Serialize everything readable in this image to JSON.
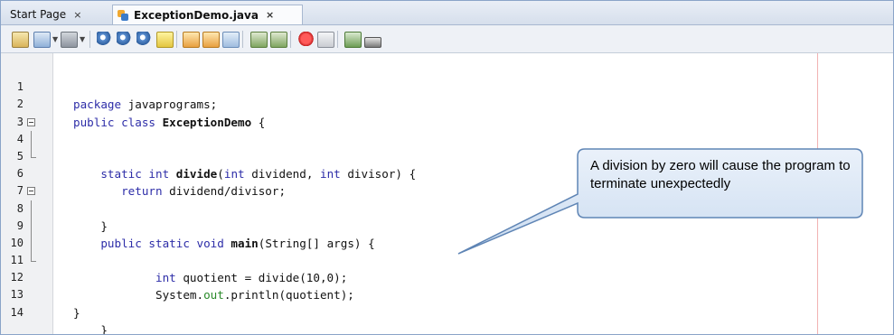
{
  "tabs": [
    {
      "label": "Start Page",
      "active": false,
      "close": "×"
    },
    {
      "label": "ExceptionDemo.java",
      "active": true,
      "close": "×",
      "icon": "java-file-icon"
    }
  ],
  "toolbar": {
    "buttons": [
      "last-edit-icon",
      "back-icon",
      "forward-icon",
      "find-selection-icon",
      "find-previous-icon",
      "find-next-icon",
      "toggle-highlight-icon",
      "previous-bookmark-icon",
      "next-bookmark-icon",
      "toggle-bookmark-icon",
      "shift-left-icon",
      "shift-right-icon",
      "start-macro-icon",
      "stop-macro-icon",
      "comment-icon",
      "uncomment-icon"
    ]
  },
  "editor": {
    "lines": [
      {
        "num": "1",
        "code": "package javaprograms;"
      },
      {
        "num": "2",
        "code": "public class ExceptionDemo {"
      },
      {
        "num": "3",
        "code": ""
      },
      {
        "num": "4",
        "code": "    static int divide(int dividend, int divisor) {"
      },
      {
        "num": "5",
        "code": "       return dividend/divisor;"
      },
      {
        "num": "6",
        "code": "    }"
      },
      {
        "num": "7",
        "code": ""
      },
      {
        "num": "8",
        "code": "    public static void main(String[] args) {"
      },
      {
        "num": "9",
        "code": ""
      },
      {
        "num": "10",
        "code": "            int quotient = divide(10,0);"
      },
      {
        "num": "11",
        "code": "            System.out.println(quotient);"
      },
      {
        "num": "12",
        "code": "    }"
      },
      {
        "num": "13",
        "code": "}"
      },
      {
        "num": "14",
        "code": ""
      }
    ]
  },
  "callout": {
    "text": "A division by zero will cause the program to terminate unexpectedly",
    "fill": "#dce8f5",
    "border": "#5f85b5"
  },
  "colors": {
    "keyword": "#2d2da8",
    "field": "#2a8a2a",
    "margin_line": "#f1b3b3"
  }
}
